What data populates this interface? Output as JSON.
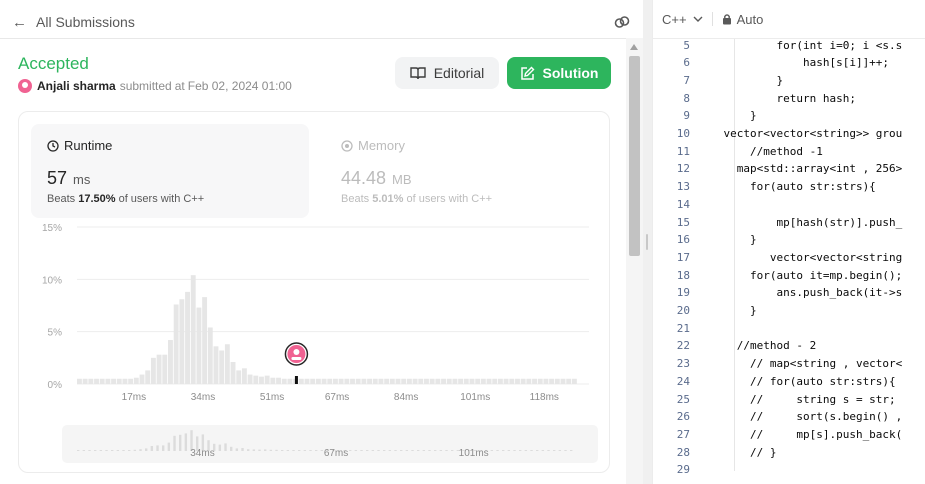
{
  "header": {
    "back_label": "All Submissions",
    "back_icon": "arrow-left-icon",
    "link_icon": "link-icon"
  },
  "submission": {
    "status": "Accepted",
    "author": "Anjali sharma",
    "submitted_text": "submitted",
    "at_text": "at",
    "date": "Feb 02, 2024 01:00"
  },
  "buttons": {
    "editorial": "Editorial",
    "solution": "Solution"
  },
  "runtime": {
    "title": "Runtime",
    "value": "57",
    "unit": "ms",
    "beats_prefix": "Beats",
    "beats_pct": "17.50%",
    "beats_suffix": "of users with C++"
  },
  "memory": {
    "title": "Memory",
    "value": "44.48",
    "unit": "MB",
    "beats_prefix": "Beats",
    "beats_pct": "5.01%",
    "beats_suffix": "of users with C++"
  },
  "colors": {
    "accent_green": "#2db55d",
    "bar": "#e6e6e6",
    "marker": "#e91e63"
  },
  "chart_data": {
    "type": "bar",
    "y_ticks": [
      "15%",
      "10%",
      "5%",
      "0%"
    ],
    "ylim": [
      0,
      15
    ],
    "x_ticks": [
      "17ms",
      "34ms",
      "51ms",
      "67ms",
      "84ms",
      "101ms",
      "118ms"
    ],
    "x_tick_values": [
      17,
      34,
      51,
      67,
      84,
      101,
      118
    ],
    "xlim": [
      3,
      129
    ],
    "bar_width_ms": 1.2,
    "bar_step_ms": 1.4,
    "values": [
      0.5,
      0.5,
      0.5,
      0.5,
      0.5,
      0.5,
      0.5,
      0.5,
      0.5,
      0.5,
      0.6,
      0.9,
      1.3,
      2.5,
      2.8,
      2.8,
      4.2,
      7.6,
      8.1,
      8.8,
      10.4,
      7.3,
      8.3,
      5.4,
      3.6,
      3.2,
      3.8,
      2.1,
      1.3,
      1.5,
      0.9,
      0.8,
      0.7,
      0.8,
      0.6,
      0.6,
      0.5,
      0.5,
      0.5,
      0.5,
      0.5,
      0.5,
      0.5,
      0.5,
      0.5,
      0.5,
      0.5,
      0.5,
      0.5,
      0.5,
      0.5,
      0.5,
      0.5,
      0.5,
      0.5,
      0.5,
      0.5,
      0.5,
      0.5,
      0.5,
      0.5,
      0.5,
      0.5,
      0.5,
      0.5,
      0.5,
      0.5,
      0.5,
      0.5,
      0.5,
      0.5,
      0.5,
      0.5,
      0.5,
      0.5,
      0.5,
      0.5,
      0.5,
      0.5,
      0.5,
      0.5,
      0.5,
      0.5,
      0.5,
      0.5,
      0.5,
      0.5,
      0.5
    ],
    "highlight_value_ms": 57,
    "overview_ticks": [
      "34ms",
      "67ms",
      "101ms"
    ],
    "overview_tick_values": [
      34,
      67,
      101
    ]
  },
  "editor": {
    "language": "C++",
    "mode": "Auto",
    "lines": [
      {
        "n": "5",
        "code": "            for(int i=0; i <s.s"
      },
      {
        "n": "6",
        "code": "                hash[s[i]]++;"
      },
      {
        "n": "7",
        "code": "            }"
      },
      {
        "n": "8",
        "code": "            return hash;"
      },
      {
        "n": "9",
        "code": "        }"
      },
      {
        "n": "10",
        "code": "    vector<vector<string>> grou"
      },
      {
        "n": "11",
        "code": "        //method -1"
      },
      {
        "n": "12",
        "code": "      map<std::array<int , 256>"
      },
      {
        "n": "13",
        "code": "        for(auto str:strs){"
      },
      {
        "n": "14",
        "code": ""
      },
      {
        "n": "15",
        "code": "            mp[hash(str)].push_"
      },
      {
        "n": "16",
        "code": "        }"
      },
      {
        "n": "17",
        "code": "           vector<vector<string"
      },
      {
        "n": "18",
        "code": "        for(auto it=mp.begin();"
      },
      {
        "n": "19",
        "code": "            ans.push_back(it->s"
      },
      {
        "n": "20",
        "code": "        }"
      },
      {
        "n": "21",
        "code": ""
      },
      {
        "n": "22",
        "code": "      //method - 2"
      },
      {
        "n": "23",
        "code": "        // map<string , vector<"
      },
      {
        "n": "24",
        "code": "        // for(auto str:strs){"
      },
      {
        "n": "25",
        "code": "        //     string s = str;"
      },
      {
        "n": "26",
        "code": "        //     sort(s.begin() ,"
      },
      {
        "n": "27",
        "code": "        //     mp[s].push_back("
      },
      {
        "n": "28",
        "code": "        // }"
      },
      {
        "n": "29",
        "code": ""
      }
    ]
  }
}
